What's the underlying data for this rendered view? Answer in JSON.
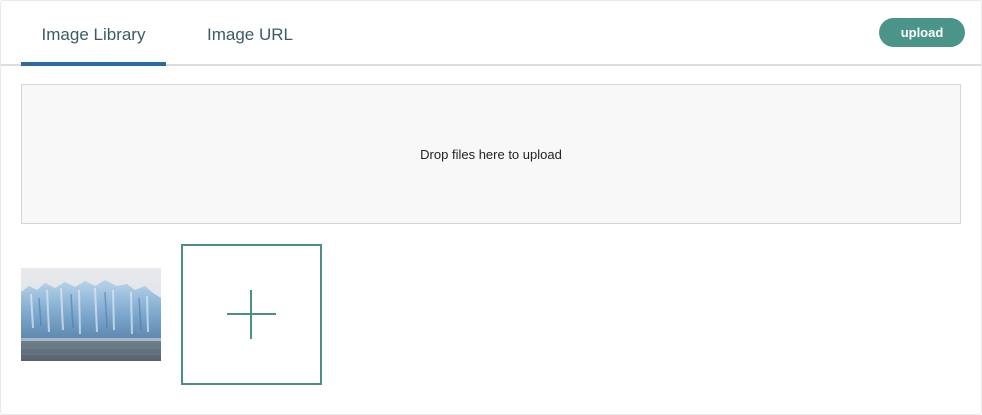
{
  "tabs": [
    {
      "label": "Image Library",
      "active": true
    },
    {
      "label": "Image URL",
      "active": false
    }
  ],
  "upload_button": {
    "label": "upload"
  },
  "dropzone": {
    "text": "Drop files here to upload"
  },
  "library": {
    "images": [
      {
        "description": "glacier photo thumbnail"
      }
    ],
    "add_tile_icon": "plus-icon"
  },
  "colors": {
    "accent": "#4b9489",
    "tab_underline": "#2a6aa0",
    "tab_text": "#3a5c66",
    "dropzone_bg": "#f8f8f8"
  }
}
